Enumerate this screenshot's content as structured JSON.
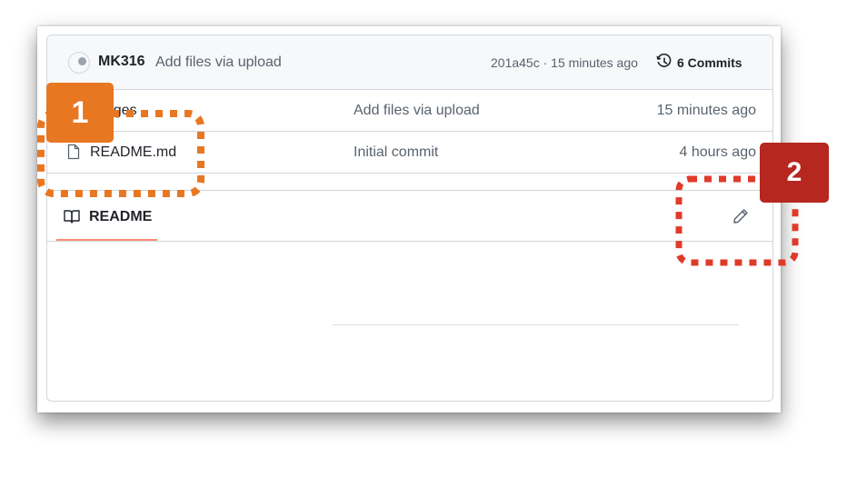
{
  "commit_bar": {
    "author": "MK316",
    "message": "Add files via upload",
    "meta": "201a45c · 15 minutes ago",
    "commits_label": "6 Commits",
    "icon": "history-icon"
  },
  "files": [
    {
      "name": "images",
      "message": "Add files via upload",
      "age": "15 minutes ago",
      "icon": "folder-icon"
    },
    {
      "name": "README.md",
      "message": "Initial commit",
      "age": "4 hours ago",
      "icon": "file-icon"
    }
  ],
  "readme": {
    "tab_label": "README",
    "icon": "book-icon",
    "edit_icon": "pencil-icon"
  },
  "callouts": [
    {
      "number": "1",
      "color": "#e87722"
    },
    {
      "number": "2",
      "color": "#b5271f"
    }
  ]
}
